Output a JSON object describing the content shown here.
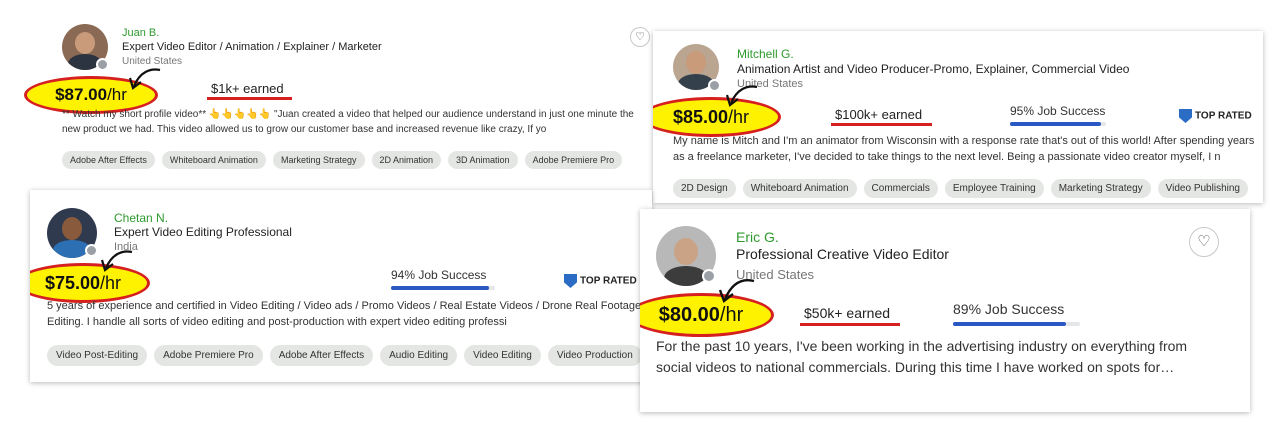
{
  "accent_colors": {
    "name_green": "#2e9a2e",
    "highlight_yellow": "#fff200",
    "annotation_red": "#d61f1f",
    "job_success_blue": "#2b59c3"
  },
  "cards": [
    {
      "name": "Juan B.",
      "title": "Expert Video Editor / Animation / Explainer / Marketer",
      "location": "United States",
      "rate": "$87.00",
      "rate_unit": "/hr",
      "earned": "$1k+ earned",
      "description": "** Watch my short profile video** 👆👆👆👆👆 \"Juan created a video that helped our audience understand in just one minute the new product we had. This video allowed us to grow our customer base and increased revenue like crazy, If yo",
      "skills": [
        "Adobe After Effects",
        "Whiteboard Animation",
        "Marketing Strategy",
        "2D Animation",
        "3D Animation",
        "Adobe Premiere Pro"
      ],
      "heart_icon": "heart-icon"
    },
    {
      "name": "Mitchell G.",
      "title": "Animation Artist and Video Producer-Promo, Explainer, Commercial Video",
      "location": "United States",
      "rate": "$85.00",
      "rate_unit": "/hr",
      "earned": "$100k+ earned",
      "job_success": "95% Job Success",
      "job_success_value": 0.95,
      "top_rated": "TOP RATED",
      "description": "My name is Mitch and I'm an animator from Wisconsin with a response rate that's out of this world! After spending years as a freelance marketer, I've decided to take things to the next level. Being a passionate video creator myself, I n",
      "skills": [
        "2D Design",
        "Whiteboard Animation",
        "Commercials",
        "Employee Training",
        "Marketing Strategy",
        "Video Publishing"
      ]
    },
    {
      "name": "Chetan N.",
      "title": "Expert Video Editing Professional",
      "location": "India",
      "rate": "$75.00",
      "rate_unit": "/hr",
      "job_success": "94% Job Success",
      "job_success_value": 0.94,
      "top_rated": "TOP RATED",
      "description": "5 years of experience and certified in Video Editing / Video ads / Promo Videos / Real Estate Videos / Drone Real Footage Editing. I handle all sorts of video editing and post-production with expert video editing professi",
      "skills": [
        "Video Post-Editing",
        "Adobe Premiere Pro",
        "Adobe After Effects",
        "Audio Editing",
        "Video Editing",
        "Video Production"
      ]
    },
    {
      "name": "Eric G.",
      "title": "Professional Creative Video Editor",
      "location": "United States",
      "rate": "$80.00",
      "rate_unit": "/hr",
      "earned": "$50k+ earned",
      "job_success": "89% Job Success",
      "job_success_value": 0.89,
      "description": "For the past 10 years, I've been working in the advertising industry on everything from social videos to national commercials. During this time I have worked on spots for…",
      "heart_icon": "heart-icon"
    }
  ]
}
